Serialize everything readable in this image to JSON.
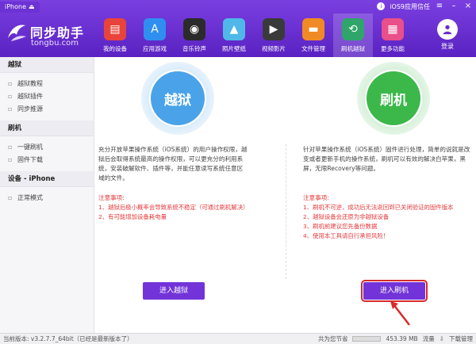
{
  "titlebar": {
    "device_tab": "iPhone",
    "device_tab_icon": "eject-icon",
    "trust_label": "iOS9应用信任"
  },
  "logo": {
    "title": "同步助手",
    "subtitle": "tongbu.com"
  },
  "nav": {
    "items": [
      {
        "label": "我的设备",
        "icon": "store-icon",
        "color": "#e8443b",
        "glyph": "▤"
      },
      {
        "label": "应用游戏",
        "icon": "app-store-icon",
        "color": "#2f8ff0",
        "glyph": "A"
      },
      {
        "label": "音乐铃声",
        "icon": "music-disc-icon",
        "color": "#2b2b2b",
        "glyph": "◉"
      },
      {
        "label": "照片壁纸",
        "icon": "photo-icon",
        "color": "#4fb8e8",
        "glyph": "▲"
      },
      {
        "label": "视频影片",
        "icon": "clapper-icon",
        "color": "#3a3a3a",
        "glyph": "▶"
      },
      {
        "label": "文件管理",
        "icon": "folder-icon",
        "color": "#f08a24",
        "glyph": "▬"
      },
      {
        "label": "刷机越狱",
        "icon": "flash-jailbreak-icon",
        "color": "#2fa56a",
        "glyph": "⟲"
      },
      {
        "label": "更多功能",
        "icon": "more-grid-icon",
        "color": "#e94f8a",
        "glyph": "▦"
      }
    ],
    "active_index": 6
  },
  "login": {
    "label": "登录"
  },
  "sidebar": {
    "sections": [
      {
        "title": "越狱",
        "items": [
          {
            "label": "越狱教程",
            "icon": "doc-icon"
          },
          {
            "label": "越狱插件",
            "icon": "plugin-icon"
          },
          {
            "label": "同步推源",
            "icon": "source-icon"
          }
        ]
      },
      {
        "title": "刷机",
        "items": [
          {
            "label": "一键刷机",
            "icon": "flash-icon"
          },
          {
            "label": "固件下载",
            "icon": "download-icon"
          }
        ]
      },
      {
        "title": "设备 - iPhone",
        "items": [
          {
            "label": "正常模式",
            "icon": "device-icon"
          }
        ]
      }
    ]
  },
  "jailbreak": {
    "circle_label": "越狱",
    "description": "充分开放苹果操作系统（iOS系统）的用户操作权限，越狱后会取得系统最高的操作权限，可以更充分的利用系统，安装破解软件、插件等，并能任意读写系统任意区域的文件。",
    "notes_title": "注意事项:",
    "notes": [
      "1、越狱后极小概率会导致系统不稳定（可通过刷机解决）",
      "2、有可能增加设备耗电量"
    ],
    "button": "进入越狱",
    "color": "#4aa3e8"
  },
  "flash": {
    "circle_label": "刷机",
    "description": "针对苹果操作系统（iOS系统）固件进行处理，简单的说就是改变或者更新手机的操作系统，刷机可以有效的解决白苹果，黑屏，无限Recovery等问题。",
    "notes_title": "注意事项:",
    "notes": [
      "1、刷机不可逆，成功后无法返回到已关闭验证的固件版本",
      "2、越狱设备会还原为非越狱设备",
      "3、刷机前建议您先备份数据",
      "4、使用本工具请自行承担风险！"
    ],
    "button": "进入刷机",
    "color": "#3cb84a"
  },
  "statusbar": {
    "version": "当前版本: v3.2.7.7_64bit（已经是最新版本了）",
    "saved": "共为您节省",
    "saved_amount": "453.39 MB",
    "saved_unit": "流量",
    "download": "下载管理"
  }
}
